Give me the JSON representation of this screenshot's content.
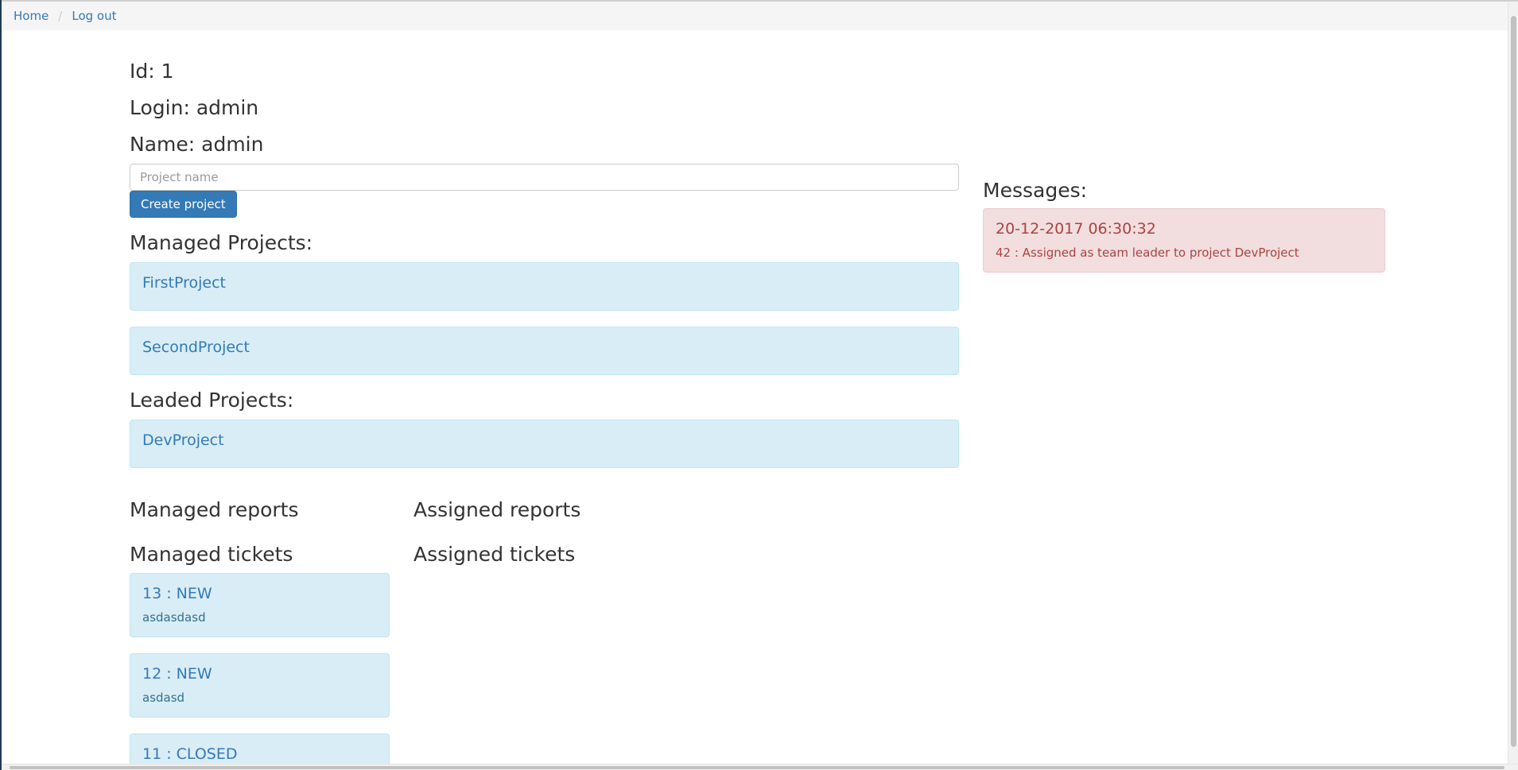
{
  "breadcrumb": {
    "home": "Home",
    "logout": "Log out"
  },
  "user": {
    "id": "Id: 1",
    "login": "Login: admin",
    "name": "Name: admin"
  },
  "create_project": {
    "placeholder": "Project name",
    "value": "",
    "button": "Create project"
  },
  "managed_projects": {
    "title": "Managed Projects:",
    "items": [
      "FirstProject",
      "SecondProject"
    ]
  },
  "leaded_projects": {
    "title": "Leaded Projects:",
    "items": [
      "DevProject"
    ]
  },
  "reports": {
    "managed_title": "Managed reports",
    "assigned_title": "Assigned reports"
  },
  "tickets": {
    "managed_title": "Managed tickets",
    "assigned_title": "Assigned tickets",
    "managed": [
      {
        "title": "13 : NEW",
        "desc": "asdasdasd"
      },
      {
        "title": "12 : NEW",
        "desc": "asdasd"
      },
      {
        "title": "11 : CLOSED",
        "desc": ""
      }
    ]
  },
  "messages": {
    "title": "Messages:",
    "items": [
      {
        "time": "20-12-2017 06:30:32",
        "text": "42 : Assigned as team leader to project DevProject"
      }
    ]
  },
  "colors": {
    "link": "#337ab7",
    "info_bg": "#d9edf7",
    "danger_bg": "#f2dede",
    "danger_text": "#a94442",
    "primary": "#337ab7"
  }
}
